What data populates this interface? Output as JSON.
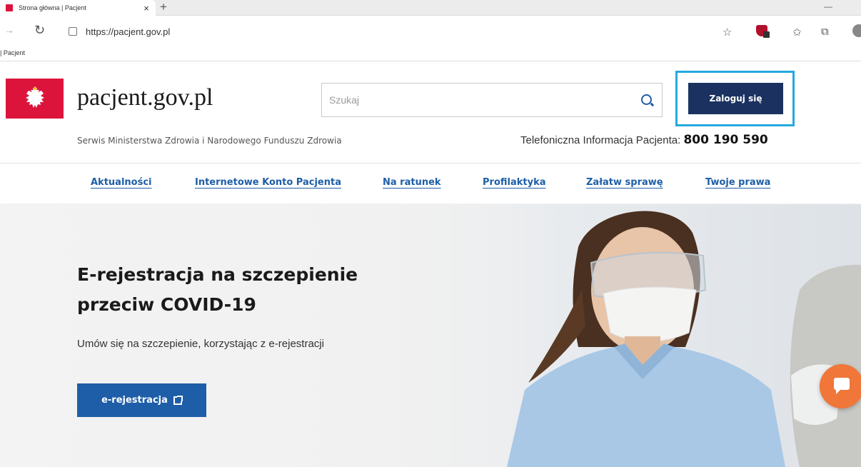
{
  "browser": {
    "tab_title": "Strona główna | Pacjent",
    "tab_close": "×",
    "new_tab": "+",
    "url": "https://pacjent.gov.pl",
    "favorites_item": "| Pacjent"
  },
  "header": {
    "site_name": "pacjent.gov.pl",
    "subtitle": "Serwis Ministerstwa Zdrowia i Narodowego Funduszu Zdrowia",
    "search_placeholder": "Szukaj",
    "login_label": "Zaloguj się",
    "phone_label": "Telefoniczna Informacja Pacjenta:",
    "phone_number": "800 190 590"
  },
  "nav": {
    "items": [
      {
        "label": "Aktualności"
      },
      {
        "label": "Internetowe Konto Pacjenta"
      },
      {
        "label": "Na ratunek"
      },
      {
        "label": "Profilaktyka"
      },
      {
        "label": "Załatw sprawę"
      },
      {
        "label": "Twoje prawa"
      }
    ]
  },
  "hero": {
    "title": "E-rejestracja na szczepienie przeciw COVID-19",
    "subtitle": "Umów się na szczepienie, korzystając z e-rejestracji",
    "button_label": "e-rejestracja"
  },
  "colors": {
    "brand_red": "#dc143c",
    "login_navy": "#1b3260",
    "link_blue": "#1e5ea8",
    "highlight_cyan": "#26a8e0",
    "chat_orange": "#f0763a"
  },
  "icons": {
    "search": "search-icon",
    "external": "external-link-icon",
    "chat": "chat-icon",
    "emblem": "polish-eagle-icon"
  }
}
